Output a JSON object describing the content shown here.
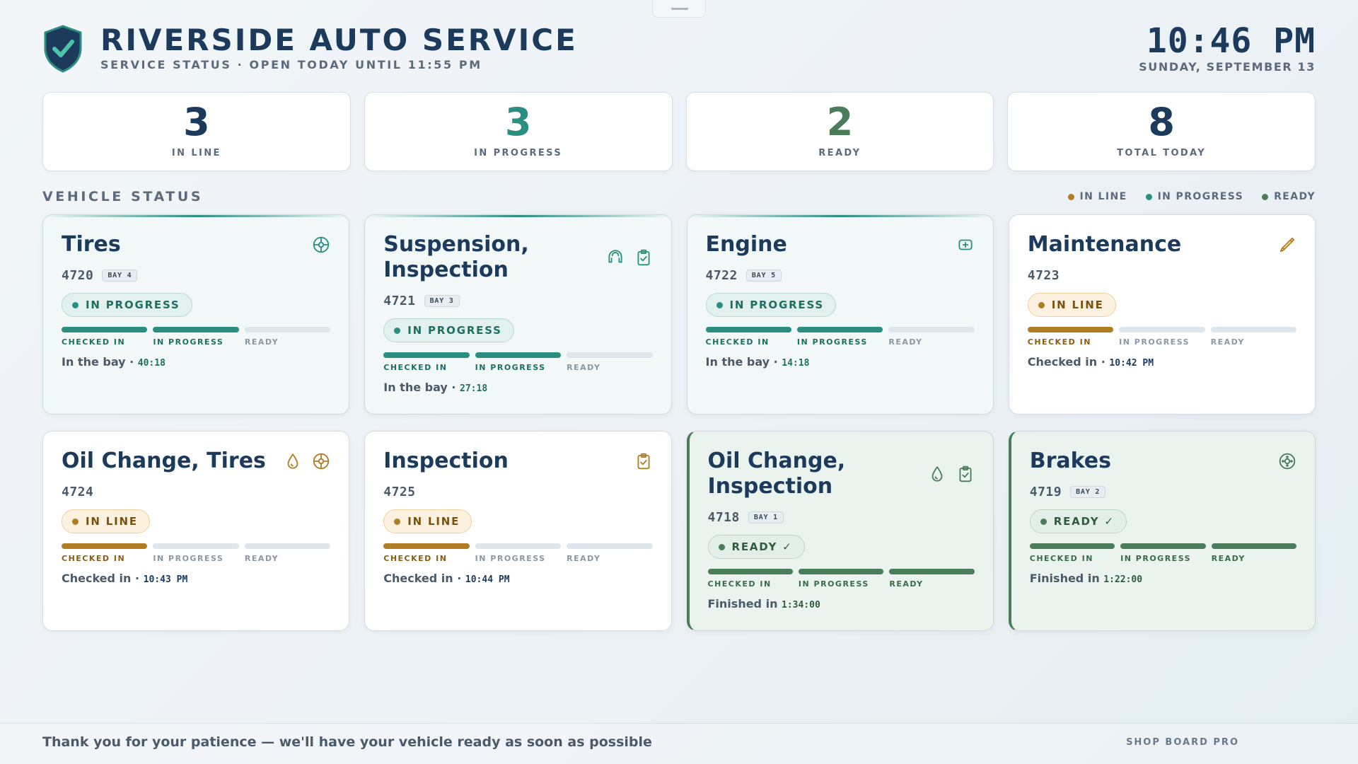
{
  "header": {
    "title": "RIVERSIDE AUTO SERVICE",
    "subtitle": "SERVICE STATUS · OPEN TODAY UNTIL 11:55 PM",
    "time": "10:46 PM",
    "date": "SUNDAY, SEPTEMBER 13",
    "logo_icon": "shield-check-icon"
  },
  "colors": {
    "navy": "#1b3a5c",
    "inline": "#b07d24",
    "progress": "#2a8f80",
    "ready": "#4a7c59",
    "muted": "#5b6b7c"
  },
  "stats": [
    {
      "value": "3",
      "label": "IN LINE",
      "color": "#1b3a5c"
    },
    {
      "value": "3",
      "label": "IN PROGRESS",
      "color": "#2a8f80"
    },
    {
      "value": "2",
      "label": "READY",
      "color": "#4a7c59"
    },
    {
      "value": "8",
      "label": "TOTAL TODAY",
      "color": "#1b3a5c"
    }
  ],
  "section": {
    "title": "VEHICLE STATUS",
    "legend": [
      {
        "label": "IN LINE",
        "color": "#b07d24"
      },
      {
        "label": "IN PROGRESS",
        "color": "#2a8f80"
      },
      {
        "label": "READY",
        "color": "#4a7c59"
      }
    ]
  },
  "steps": [
    "CHECKED IN",
    "IN PROGRESS",
    "READY"
  ],
  "vehicles": [
    {
      "title": "Tires",
      "ticket": "4720",
      "bay": "BAY 4",
      "status": "progress",
      "status_label": "IN PROGRESS",
      "steps_done": 2,
      "line_label": "In the bay",
      "line_sep": " · ",
      "line_value": "40:18",
      "icons": [
        "tire-icon"
      ]
    },
    {
      "title": "Suspension, Inspection",
      "ticket": "4721",
      "bay": "BAY 3",
      "status": "progress",
      "status_label": "IN PROGRESS",
      "steps_done": 2,
      "line_label": "In the bay",
      "line_sep": " · ",
      "line_value": "27:18",
      "icons": [
        "suspension-icon",
        "clipboard-check-icon"
      ]
    },
    {
      "title": "Engine",
      "ticket": "4722",
      "bay": "BAY 5",
      "status": "progress",
      "status_label": "IN PROGRESS",
      "steps_done": 2,
      "line_label": "In the bay",
      "line_sep": " · ",
      "line_value": "14:18",
      "icons": [
        "engine-icon"
      ]
    },
    {
      "title": "Maintenance",
      "ticket": "4723",
      "bay": "",
      "status": "inline",
      "status_label": "IN LINE",
      "steps_done": 1,
      "line_label": "Checked in",
      "line_sep": " · ",
      "line_value": "10:42 PM",
      "icons": [
        "wrench-icon"
      ]
    },
    {
      "title": "Oil Change, Tires",
      "ticket": "4724",
      "bay": "",
      "status": "inline",
      "status_label": "IN LINE",
      "steps_done": 1,
      "line_label": "Checked in",
      "line_sep": " · ",
      "line_value": "10:43 PM",
      "icons": [
        "oil-drop-icon",
        "tire-icon"
      ]
    },
    {
      "title": "Inspection",
      "ticket": "4725",
      "bay": "",
      "status": "inline",
      "status_label": "IN LINE",
      "steps_done": 1,
      "line_label": "Checked in",
      "line_sep": " · ",
      "line_value": "10:44 PM",
      "icons": [
        "clipboard-check-icon"
      ]
    },
    {
      "title": "Oil Change, Inspection",
      "ticket": "4718",
      "bay": "BAY 1",
      "status": "ready",
      "status_label": "READY ✓",
      "steps_done": 3,
      "line_label": "Finished in",
      "line_sep": " ",
      "line_value": "1:34:00",
      "icons": [
        "oil-drop-icon",
        "clipboard-check-icon"
      ]
    },
    {
      "title": "Brakes",
      "ticket": "4719",
      "bay": "BAY 2",
      "status": "ready",
      "status_label": "READY ✓",
      "steps_done": 3,
      "line_label": "Finished in",
      "line_sep": " ",
      "line_value": "1:22:00",
      "icons": [
        "brake-disc-icon"
      ]
    }
  ],
  "footer": {
    "message": "Thank you for your patience — we'll have your vehicle ready as soon as possible",
    "brand": "SHOP BOARD PRO"
  }
}
